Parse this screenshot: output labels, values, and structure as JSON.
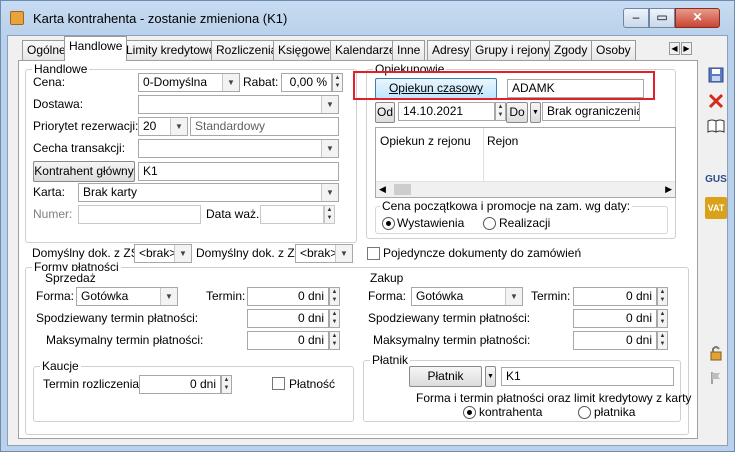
{
  "window": {
    "title": "Karta kontrahenta - zostanie zmieniona (K1)",
    "min_label": "–",
    "max_label": "▭",
    "close_label": "✕"
  },
  "tabs": [
    {
      "label": "Ogólne",
      "active": false
    },
    {
      "label": "Handlowe",
      "active": true
    },
    {
      "label": "Limity kredytowe",
      "active": false
    },
    {
      "label": "Rozliczenia",
      "active": false
    },
    {
      "label": "Księgowe",
      "active": false
    },
    {
      "label": "Kalendarze",
      "active": false
    },
    {
      "label": "Inne",
      "active": false
    },
    {
      "label": "Adresy",
      "active": false
    },
    {
      "label": "Grupy i rejony",
      "active": false
    },
    {
      "label": "Zgody",
      "active": false
    },
    {
      "label": "Osoby",
      "active": false
    }
  ],
  "handlowe": {
    "group_title": "Handlowe",
    "cena_label": "Cena:",
    "cena_value": "0-Domyślna",
    "rabat_label": "Rabat:",
    "rabat_value": "0,00 %",
    "dostawa_label": "Dostawa:",
    "dostawa_value": "",
    "priorytet_label": "Priorytet rezerwacji:",
    "priorytet_value": "20",
    "priorytet_desc": "Standardowy",
    "cecha_label": "Cecha transakcji:",
    "cecha_value": "",
    "kontrahent_glowny_button": "Kontrahent główny",
    "kontrahent_glowny_value": "K1",
    "karta_label": "Karta:",
    "karta_value": "Brak karty",
    "numer_label": "Numer:",
    "numer_value": "",
    "data_waz_label": "Data waż.",
    "data_waz_value": ""
  },
  "opiekunowie": {
    "group_title": "Opiekunowie",
    "opiekun_button": "Opiekun czasowy",
    "opiekun_value": "ADAMK",
    "od_button": "Od",
    "od_value": "14.10.2021",
    "do_button": "Do",
    "do_value": "Brak ograniczenia",
    "list_columns": [
      "Opiekun z rejonu",
      "Rejon"
    ],
    "cena_group_title": "Cena początkowa i promocje na zam. wg daty:",
    "radio_wystawienia": "Wystawienia",
    "radio_realizacji": "Realizacji"
  },
  "dokumenty": {
    "zs_label": "Domyślny dok. z ZS",
    "zs_value": "<brak>",
    "zz_label": "Domyślny dok. z ZZ",
    "zz_value": "<brak>",
    "pojedyncze_label": "Pojedyncze dokumenty do zamówień"
  },
  "formy": {
    "group_title": "Formy płatności",
    "sprzedaz": {
      "title": "Sprzedaż",
      "forma_label": "Forma:",
      "forma_value": "Gotówka",
      "termin_label": "Termin:",
      "termin_value": "0 dni",
      "spodziewany_label": "Spodziewany termin płatności:",
      "spodziewany_value": "0 dni",
      "maksymalny_label": "Maksymalny termin płatności:",
      "maksymalny_value": "0 dni"
    },
    "zakup": {
      "title": "Zakup",
      "forma_label": "Forma:",
      "forma_value": "Gotówka",
      "termin_label": "Termin:",
      "termin_value": "0 dni",
      "spodziewany_label": "Spodziewany termin płatności:",
      "spodziewany_value": "0 dni",
      "maksymalny_label": "Maksymalny termin płatności:",
      "maksymalny_value": "0 dni"
    }
  },
  "kaucje": {
    "title": "Kaucje",
    "termin_label": "Termin rozliczenia:",
    "termin_value": "0 dni",
    "platnosc_label": "Płatność"
  },
  "platnik": {
    "title": "Płatnik",
    "button": "Płatnik",
    "value": "K1",
    "desc": "Forma i termin płatności oraz limit kredytowy z karty",
    "radio_kontrahenta": "kontrahenta",
    "radio_platnika": "płatnika"
  },
  "sidebar": {
    "save_icon": "save-icon",
    "delete_icon": "delete-icon",
    "book_icon": "book-icon",
    "gus_label": "GUS",
    "vat_label": "VAT"
  },
  "colors": {
    "highlight": "#e0202a",
    "window_border": "#6d8bb1"
  }
}
